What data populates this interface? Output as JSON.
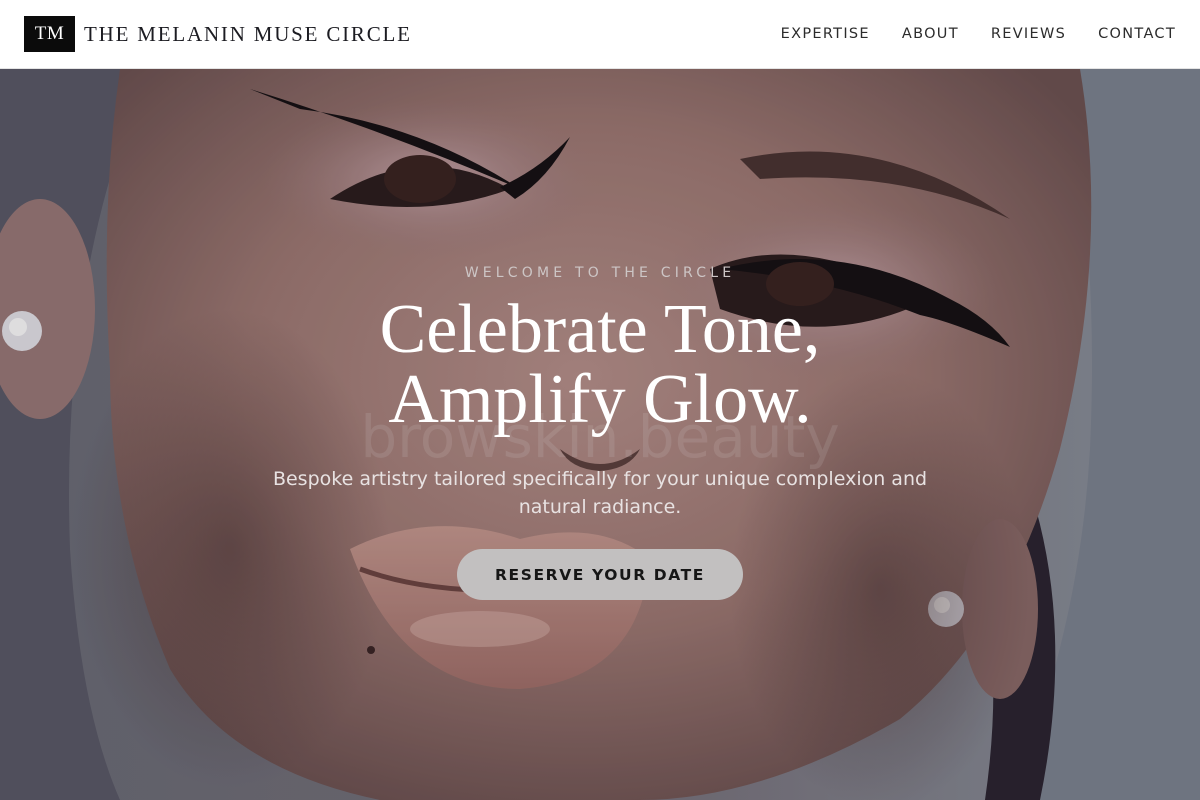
{
  "brand": {
    "logo_initials": "TM",
    "name": "THE MELANIN MUSE CIRCLE"
  },
  "nav": {
    "items": [
      {
        "label": "EXPERTISE"
      },
      {
        "label": "ABOUT"
      },
      {
        "label": "REVIEWS"
      },
      {
        "label": "CONTACT"
      }
    ]
  },
  "hero": {
    "eyebrow": "WELCOME TO THE CIRCLE",
    "headline_line1": "Celebrate Tone,",
    "headline_line2": "Amplify Glow.",
    "subtext": "Bespoke artistry tailored specifically for your unique complexion and natural radiance.",
    "cta_label": "RESERVE YOUR DATE",
    "watermark": "browskin.beauty",
    "image_description": "Close-up portrait of a woman with winged eyeliner and glossy lips"
  },
  "colors": {
    "header_bg": "#ffffff",
    "logo_bg": "#0b0b0b",
    "text_dark": "#1c1c22",
    "cta_bg": "#c2c0c0",
    "hero_text": "#ffffff"
  }
}
